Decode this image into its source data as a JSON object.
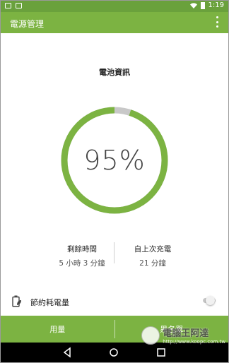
{
  "status_bar": {
    "time": "1:19",
    "icons": [
      "image-icon",
      "cast-icon",
      "wifi-icon",
      "battery-icon"
    ]
  },
  "app_bar": {
    "title": "電源管理",
    "menu_icon": "more-vert-icon"
  },
  "battery_info": {
    "title": "電池資訊",
    "percent_text": "95%",
    "level": 0.95,
    "colors": {
      "ring": "#7cb342",
      "track": "#c8c8c8"
    }
  },
  "stats": [
    {
      "label": "剩餘時間",
      "value": "5 小時 3 分鐘"
    },
    {
      "label": "自上次充電",
      "value": "21 分鐘"
    }
  ],
  "power_saver": {
    "label": "節約耗電量",
    "icon": "battery-leaf-icon",
    "enabled": false
  },
  "bottom_tabs": [
    {
      "label": "用量"
    },
    {
      "label": "黑名單"
    }
  ],
  "nav_bar": {
    "icons": [
      "back-icon",
      "home-icon",
      "recents-icon"
    ]
  },
  "watermark": {
    "title": "電腦王阿達",
    "url": "http://www.koopc.com.tw"
  },
  "colors": {
    "status_bar": "#6aa13c",
    "app_bar": "#7cb342",
    "nav_bar": "#000000"
  }
}
